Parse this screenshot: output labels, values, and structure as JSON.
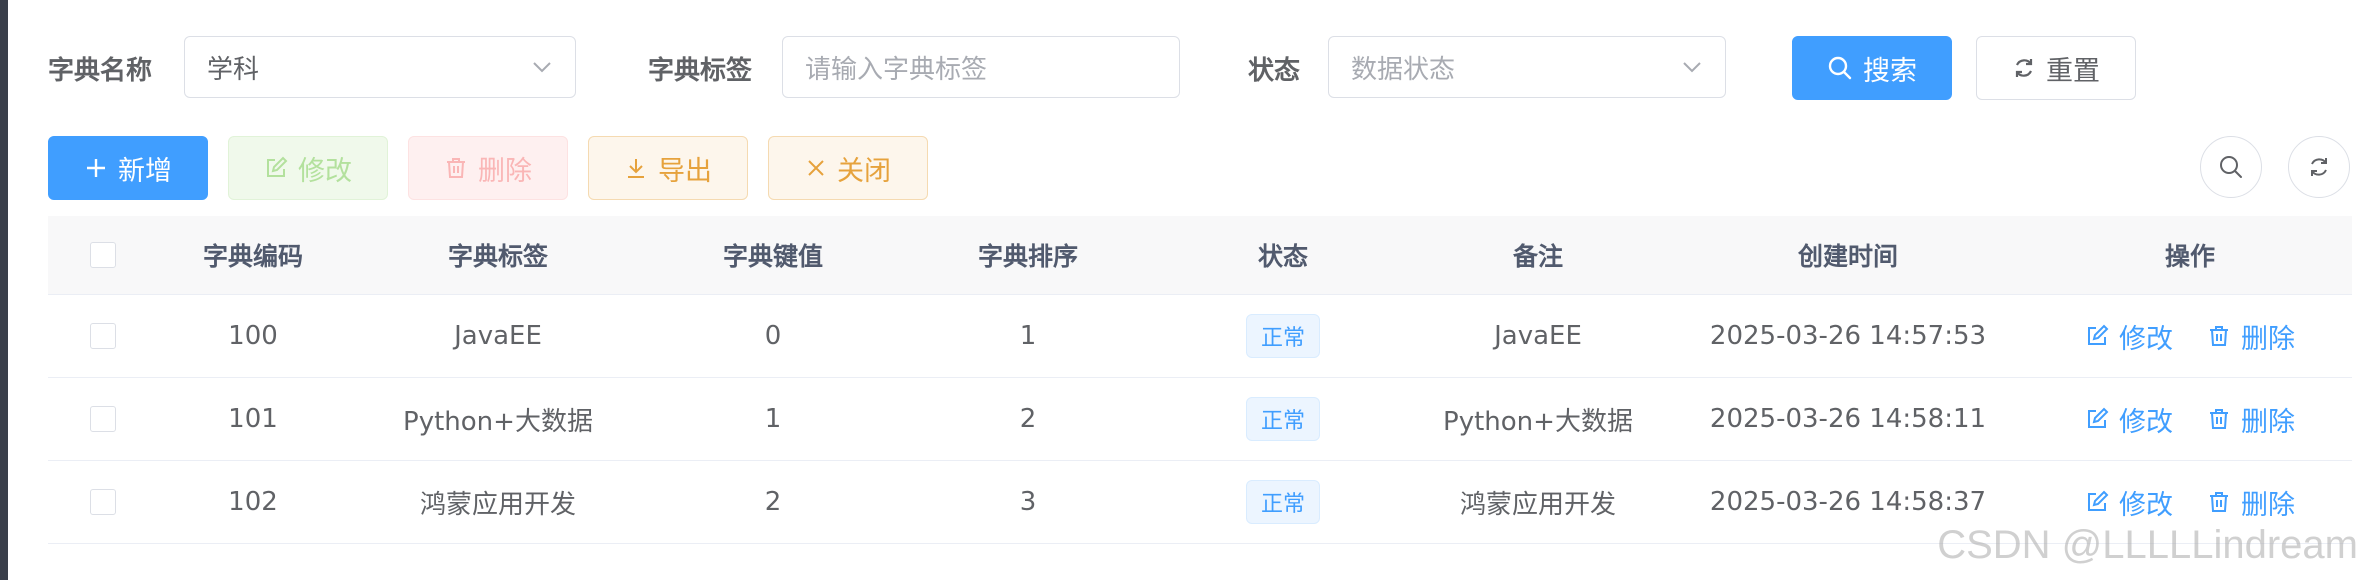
{
  "search": {
    "dict_name": {
      "label": "字典名称",
      "value": "学科"
    },
    "dict_label": {
      "label": "字典标签",
      "placeholder": "请输入字典标签"
    },
    "status": {
      "label": "状态",
      "placeholder": "数据状态"
    },
    "search_button": "搜索",
    "reset_button": "重置"
  },
  "toolbar": {
    "add": "新增",
    "edit": "修改",
    "delete": "删除",
    "export": "导出",
    "close": "关闭",
    "right_icons": [
      "search-icon",
      "refresh-icon"
    ]
  },
  "table": {
    "columns": [
      "字典编码",
      "字典标签",
      "字典键值",
      "字典排序",
      "状态",
      "备注",
      "创建时间",
      "操作"
    ],
    "rows": [
      {
        "code": "100",
        "label": "JavaEE",
        "value": "0",
        "sort": "1",
        "status": "正常",
        "remark": "JavaEE",
        "created": "2025-03-26 14:57:53",
        "edit": "修改",
        "delete": "删除"
      },
      {
        "code": "101",
        "label": "Python+大数据",
        "value": "1",
        "sort": "2",
        "status": "正常",
        "remark": "Python+大数据",
        "created": "2025-03-26 14:58:11",
        "edit": "修改",
        "delete": "删除"
      },
      {
        "code": "102",
        "label": "鸿蒙应用开发",
        "value": "2",
        "sort": "3",
        "status": "正常",
        "remark": "鸿蒙应用开发",
        "created": "2025-03-26 14:58:37",
        "edit": "修改",
        "delete": "删除"
      }
    ]
  },
  "watermark": "CSDN @LLLLLindream",
  "colors": {
    "primary": "#409eff",
    "success_light": "#f0f9eb",
    "danger_light": "#fef0f0",
    "warning": "#e6a23c",
    "border": "#dcdfe6"
  }
}
